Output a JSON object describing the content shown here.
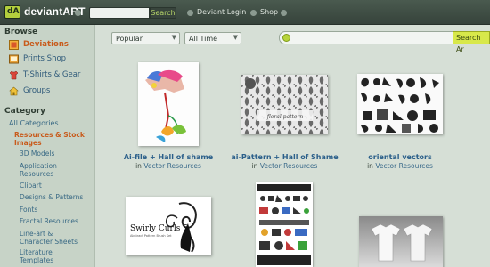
{
  "header": {
    "logo_mark": "dA",
    "logo_text": "deviantART",
    "search_placeholder": "",
    "search_button": "Search",
    "links": [
      "Deviant Login",
      "Shop"
    ]
  },
  "sidebar": {
    "browse_heading": "Browse",
    "nav": [
      {
        "label": "Deviations",
        "icon": "deviations-icon"
      },
      {
        "label": "Prints Shop",
        "icon": "prints-icon"
      },
      {
        "label": "T-Shirts & Gear",
        "icon": "tshirt-icon"
      },
      {
        "label": "Groups",
        "icon": "groups-icon"
      }
    ],
    "category_heading": "Category",
    "all_categories": "All Categories",
    "current_category": "Resources & Stock Images",
    "subcategories": [
      "3D Models",
      "Application Resources",
      "Clipart",
      "Designs & Patterns",
      "Fonts",
      "Fractal Resources",
      "Line-art & Character Sheets",
      "Literature Templates"
    ]
  },
  "toolbar": {
    "sort_value": "Popular",
    "time_value": "All Time",
    "search_button": "Search Ar"
  },
  "items": [
    {
      "title": "Ai-file + Hall of shame",
      "in_label": "in",
      "category": "Vector Resources"
    },
    {
      "title": "ai-Pattern + Hall of Shame",
      "in_label": "in",
      "category": "Vector Resources"
    },
    {
      "title": "oriental vectors",
      "in_label": "in",
      "category": "Vector Resources"
    },
    {
      "title": "",
      "in_label": "",
      "category": ""
    },
    {
      "title": "",
      "in_label": "",
      "category": ""
    },
    {
      "title": "",
      "in_label": "",
      "category": ""
    }
  ],
  "thumb_text": {
    "floral": "floral pattern",
    "swirly_title": "Swirly Curls 5",
    "swirly_sub": "Abstract Pattern Brush Set"
  },
  "colors": {
    "accent_orange": "#c85b1c",
    "link_blue": "#2b5f8a",
    "brand_green": "#b3cf3d"
  }
}
